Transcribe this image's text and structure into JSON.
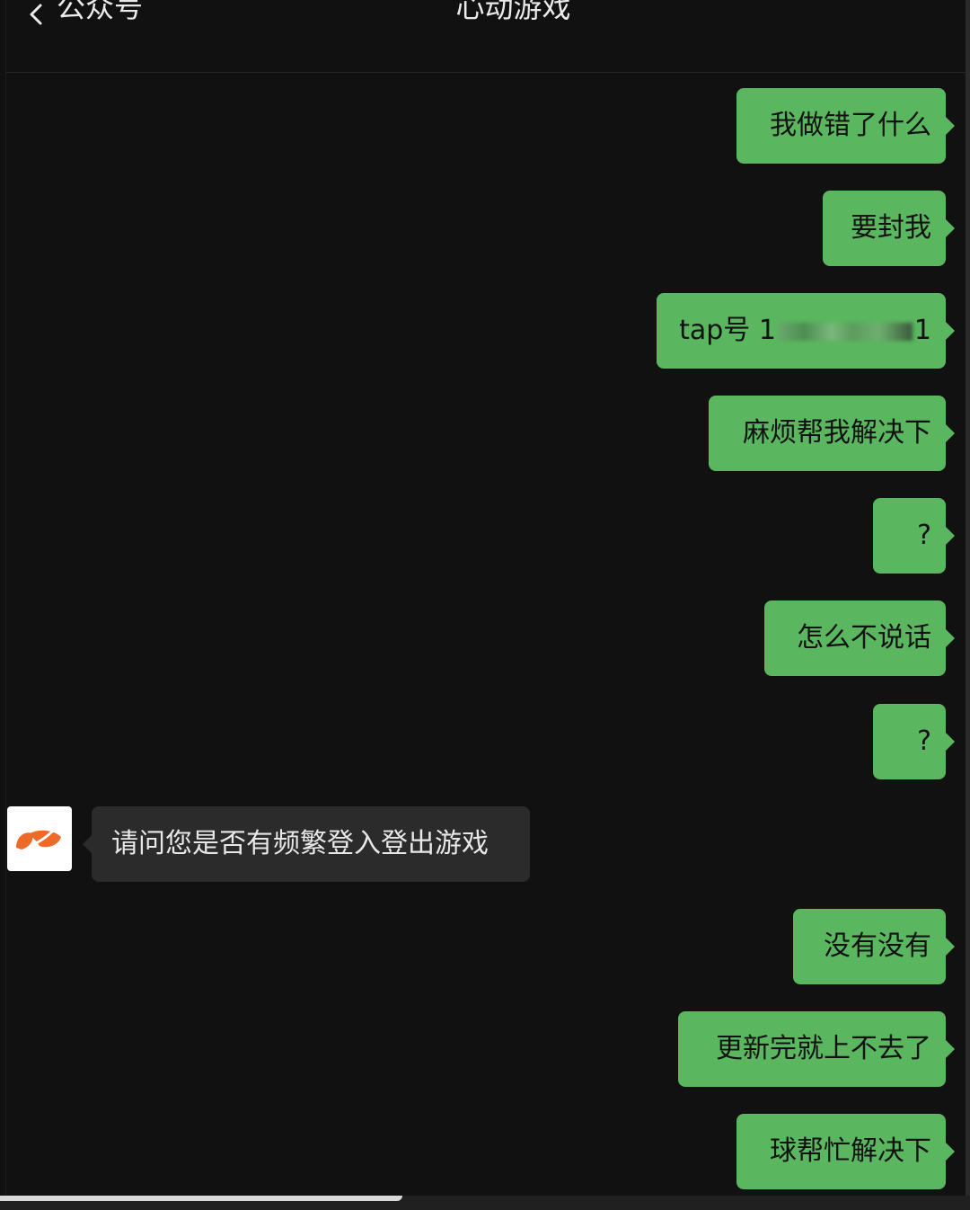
{
  "header": {
    "back_label": "公众号",
    "title": "心动游戏"
  },
  "messages": [
    {
      "from": "me",
      "text": "我做错了什么"
    },
    {
      "from": "me",
      "text": "要封我"
    },
    {
      "from": "me",
      "text_prefix": "tap号 1",
      "text_suffix": "1",
      "redacted": true
    },
    {
      "from": "me",
      "text": "麻烦帮我解决下"
    },
    {
      "from": "me",
      "text": "?"
    },
    {
      "from": "me",
      "text": "怎么不说话"
    },
    {
      "from": "me",
      "text": "?"
    },
    {
      "from": "official",
      "text": "请问您是否有频繁登入登出游戏"
    },
    {
      "from": "me",
      "text": "没有没有"
    },
    {
      "from": "me",
      "text": "更新完就上不去了"
    },
    {
      "from": "me",
      "text": "球帮忙解决下"
    }
  ],
  "colors": {
    "background": "#111111",
    "sent_bubble": "#5ab65f",
    "received_bubble": "#2b2b2b",
    "brand_logo": "#ee6a28"
  },
  "icons": {
    "back": "chevron-left-icon",
    "avatar": "xd-logo-icon"
  }
}
